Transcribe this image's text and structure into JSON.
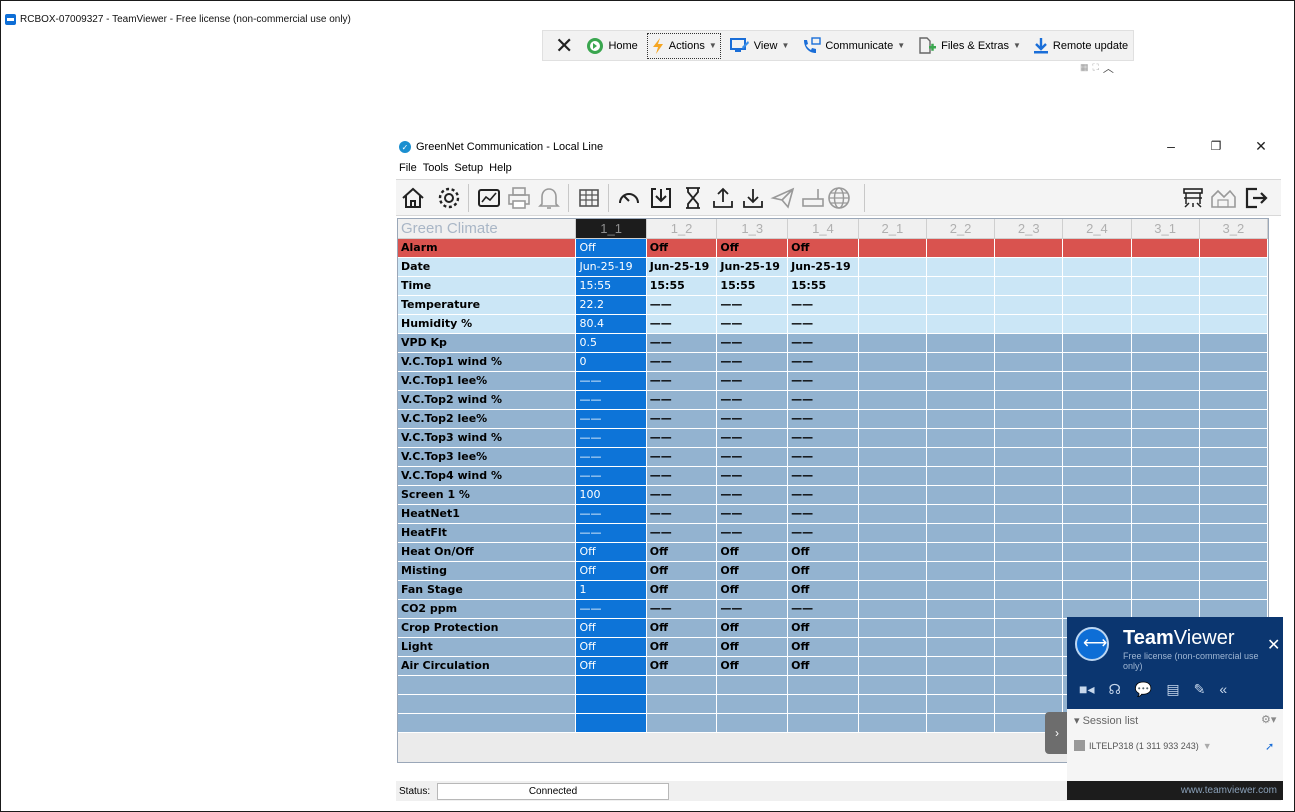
{
  "window": {
    "title": "RCBOX-07009327 - TeamViewer - Free license (non-commercial use only)"
  },
  "tv_toolbar": {
    "items": [
      "Home",
      "Actions",
      "View",
      "Communicate",
      "Files & Extras",
      "Remote update"
    ]
  },
  "app": {
    "title": "GreenNet Communication - Local Line",
    "menu": [
      "File",
      "Tools",
      "Setup",
      "Help"
    ],
    "minimize": "–",
    "restore": "❐",
    "close": "✕"
  },
  "grid": {
    "corner": "Green Climate",
    "columns": [
      "1_1",
      "1_2",
      "1_3",
      "1_4",
      "2_1",
      "2_2",
      "2_3",
      "2_4",
      "3_1",
      "3_2"
    ],
    "rows": [
      {
        "label": "Alarm",
        "values": [
          "Off",
          "Off",
          "Off",
          "Off"
        ]
      },
      {
        "label": "Date",
        "values": [
          "Jun-25-19",
          "Jun-25-19",
          "Jun-25-19",
          "Jun-25-19"
        ]
      },
      {
        "label": "Time",
        "values": [
          "15:55",
          "15:55",
          "15:55",
          "15:55"
        ]
      },
      {
        "label": "Temperature",
        "values": [
          "22.2",
          "——",
          "——",
          "——"
        ]
      },
      {
        "label": "Humidity %",
        "values": [
          "80.4",
          "——",
          "——",
          "——"
        ]
      },
      {
        "label": "VPD Kp",
        "values": [
          "0.5",
          "——",
          "——",
          "——"
        ]
      },
      {
        "label": "V.C.Top1 wind %",
        "values": [
          "0",
          "——",
          "——",
          "——"
        ]
      },
      {
        "label": "V.C.Top1 lee%",
        "values": [
          "——",
          "——",
          "——",
          "——"
        ]
      },
      {
        "label": "V.C.Top2 wind %",
        "values": [
          "——",
          "——",
          "——",
          "——"
        ]
      },
      {
        "label": "V.C.Top2 lee%",
        "values": [
          "——",
          "——",
          "——",
          "——"
        ]
      },
      {
        "label": "V.C.Top3 wind %",
        "values": [
          "——",
          "——",
          "——",
          "——"
        ]
      },
      {
        "label": "V.C.Top3 lee%",
        "values": [
          "——",
          "——",
          "——",
          "——"
        ]
      },
      {
        "label": "V.C.Top4 wind %",
        "values": [
          "——",
          "——",
          "——",
          "——"
        ]
      },
      {
        "label": "Screen 1 %",
        "values": [
          "100",
          "——",
          "——",
          "——"
        ]
      },
      {
        "label": "HeatNet1",
        "values": [
          "——",
          "——",
          "——",
          "——"
        ]
      },
      {
        "label": "HeatFlt",
        "values": [
          "——",
          "——",
          "——",
          "——"
        ]
      },
      {
        "label": "Heat On/Off",
        "values": [
          "Off",
          "Off",
          "Off",
          "Off"
        ]
      },
      {
        "label": "Misting",
        "values": [
          "Off",
          "Off",
          "Off",
          "Off"
        ]
      },
      {
        "label": "Fan Stage",
        "values": [
          "1",
          "Off",
          "Off",
          "Off"
        ]
      },
      {
        "label": "CO2 ppm",
        "values": [
          "——",
          "——",
          "——",
          "——"
        ]
      },
      {
        "label": "Crop Protection",
        "values": [
          "Off",
          "Off",
          "Off",
          "Off"
        ]
      },
      {
        "label": "Light",
        "values": [
          "Off",
          "Off",
          "Off",
          "Off"
        ]
      },
      {
        "label": "Air Circulation",
        "values": [
          "Off",
          "Off",
          "Off",
          "Off"
        ]
      }
    ]
  },
  "status": {
    "label": "Status:",
    "value": "Connected"
  },
  "teamviewer_panel": {
    "brand_bold": "Team",
    "brand_rest": "Viewer",
    "license": "Free license (non-commercial use only)",
    "session_header": "Session list",
    "session_entry": "ILTELP318 (1 311 933 243)",
    "footer": "www.teamviewer.com"
  }
}
